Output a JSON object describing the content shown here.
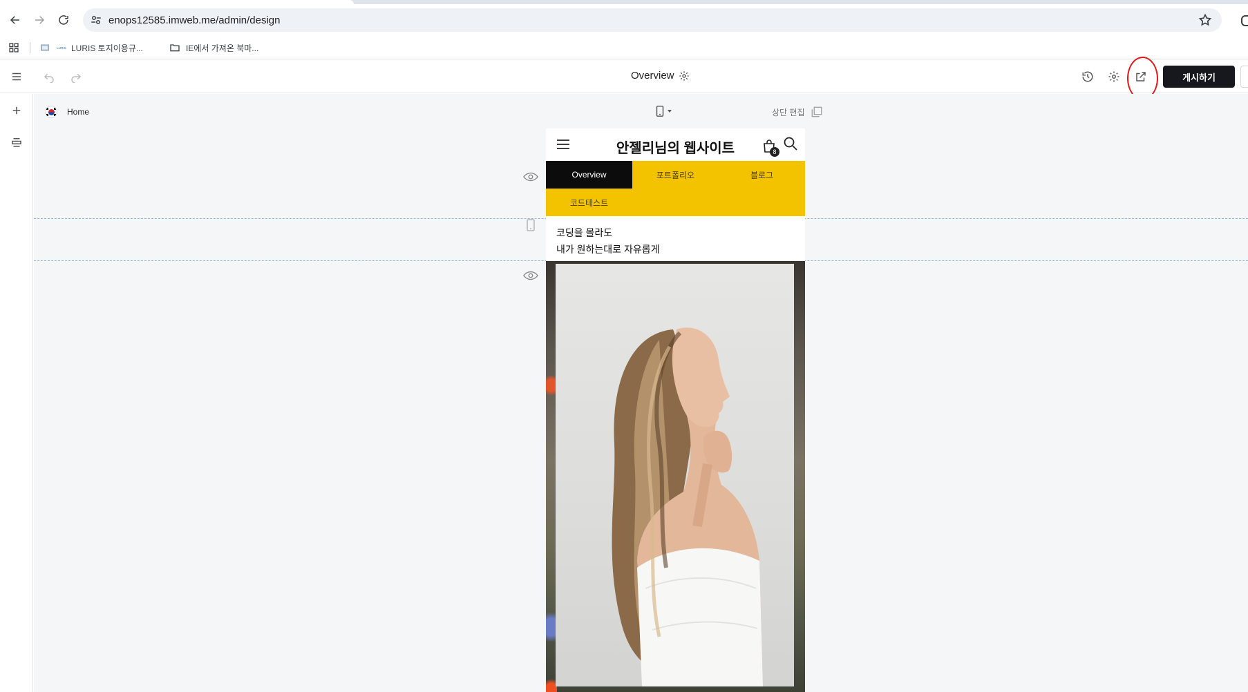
{
  "browser": {
    "url": "enops12585.imweb.me/admin/design",
    "bookmarks": [
      {
        "label": "LURIS 토지이용규..."
      },
      {
        "label": "IE에서 가져온 북마..."
      }
    ]
  },
  "editor": {
    "page_title": "Overview",
    "publish_label": "게시하기"
  },
  "canvas": {
    "page_label": "Home",
    "header_edit_label": "상단 편집"
  },
  "preview": {
    "site_title": "안젤리님의 웹사이트",
    "cart_count": "8",
    "nav_tabs": [
      {
        "label": "Overview"
      },
      {
        "label": "포트폴리오"
      },
      {
        "label": "블로그"
      },
      {
        "label": "코드테스트"
      }
    ],
    "text_line1": "코딩을 몰라도",
    "text_line2": "내가 원하는대로 자유롭게"
  },
  "colors": {
    "nav_bg": "#f3c300",
    "active_tab_bg": "#0c0c0c",
    "publish_bg": "#16181d",
    "highlight": "#e01919"
  }
}
